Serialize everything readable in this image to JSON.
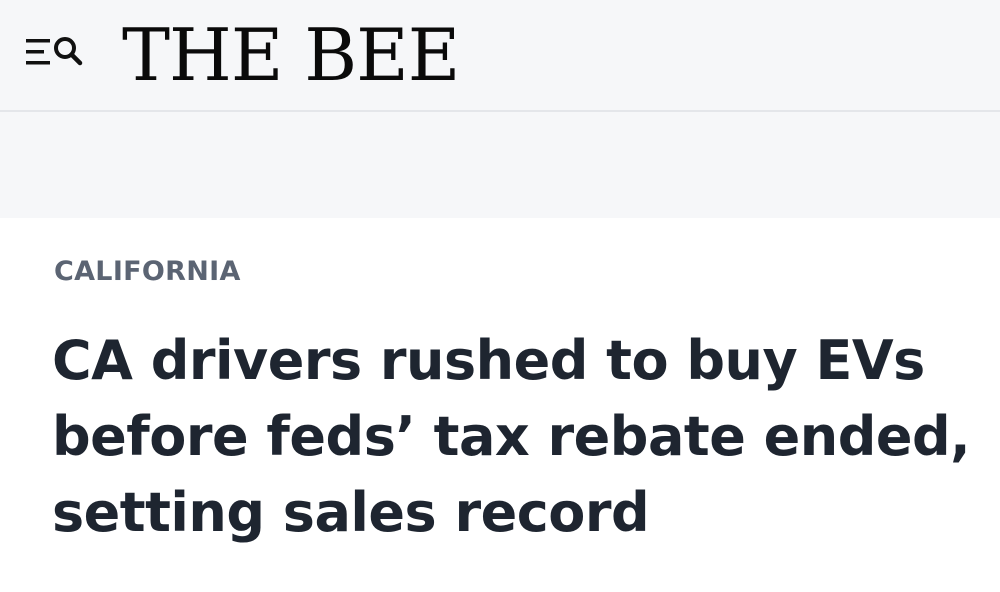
{
  "header": {
    "logo_text": "THE BEE",
    "menu_icon": "menu-icon",
    "search_icon": "search-icon"
  },
  "article": {
    "section": "CALIFORNIA",
    "headline": "CA drivers rushed to buy EVs before feds’ tax rebate ended, setting sales record"
  },
  "colors": {
    "header_bg": "#f6f7f9",
    "logo": "#0a0a0a",
    "section": "#5b6473",
    "headline": "#1e2530"
  }
}
